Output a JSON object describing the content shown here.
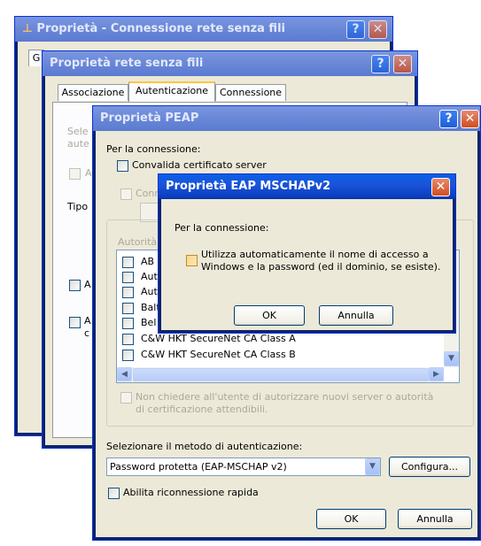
{
  "win1": {
    "title": "Proprietà - Connessione rete senza fili",
    "tab_first": "G"
  },
  "win2": {
    "title": "Proprietà rete senza fili",
    "tabs": [
      "Associazione",
      "Autenticazione",
      "Connessione"
    ],
    "desc_line1": "Sele",
    "desc_line2": "aute",
    "chk1_frag": "A",
    "tipo_label": "Tipo",
    "chk2_frag": "A",
    "chk3_frag_1": "A",
    "chk3_frag_2": "c"
  },
  "peap": {
    "title": "Proprietà PEAP",
    "for_connection": "Per la connessione:",
    "validate_cert": "Convalida certificato server",
    "connect_frag": "Conn",
    "authorities_frag": "Autorità",
    "ca_list": [
      "AB",
      "Aut",
      "Aut",
      "Balt",
      "Bel",
      "C&W HKT SecureNet CA Class A",
      "C&W HKT SecureNet CA Class B"
    ],
    "no_prompt": "Non chiedere all'utente di autorizzare nuovi server o autorità",
    "no_prompt_line2": "di certificazione attendibili.",
    "select_method_label": "Selezionare il metodo di autenticazione:",
    "method_value": "Password protetta (EAP-MSCHAP v2)",
    "configure_button": "Configura...",
    "fast_reconnect": "Abilita riconnessione rapida",
    "ok_button": "OK",
    "cancel_button": "Annulla"
  },
  "mschap": {
    "title": "Proprietà EAP MSCHAPv2",
    "for_connection": "Per la connessione:",
    "auto_logon_line1": "Utilizza automaticamente il nome di accesso a",
    "auto_logon_line2": "Windows e la password (ed il dominio, se esiste).",
    "ok_button": "OK",
    "cancel_button": "Annulla"
  },
  "icons": {
    "help": "?",
    "close": "✕",
    "dropdown": "▼",
    "scroll_left": "◀",
    "scroll_right": "▶",
    "scroll_down": "▼"
  }
}
